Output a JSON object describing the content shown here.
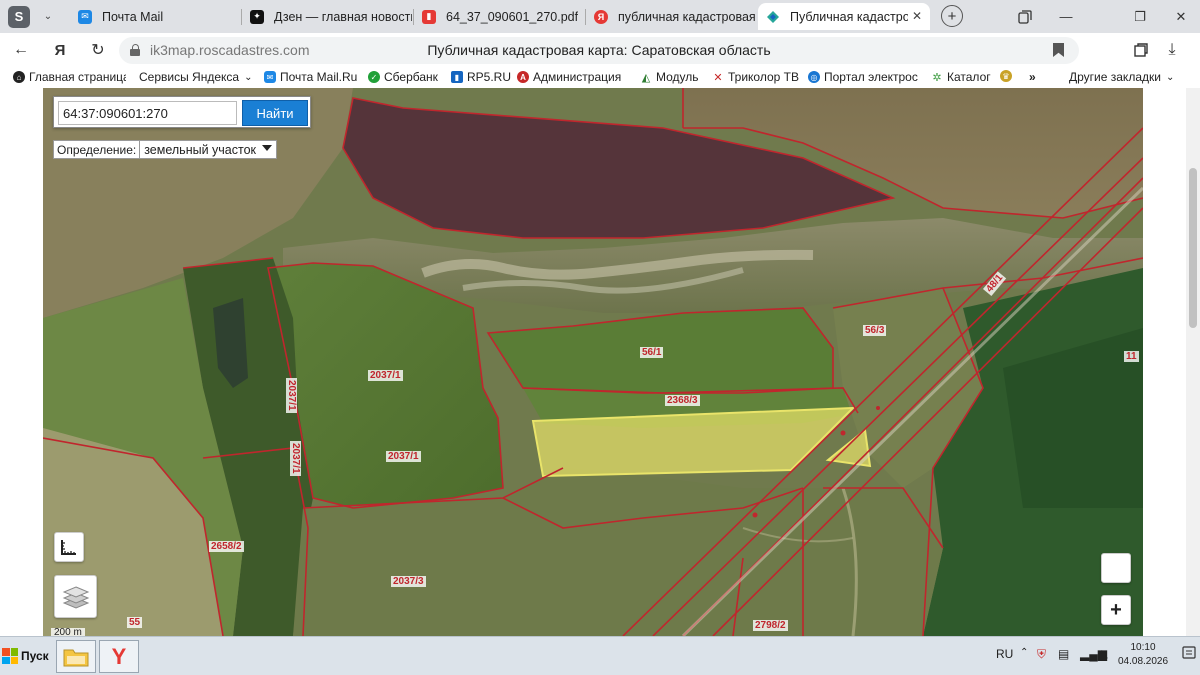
{
  "browser": {
    "tabs": [
      {
        "label": "Почта Mail",
        "icon": "mail-icon",
        "color": "#1e88e5",
        "active": false
      },
      {
        "label": "Дзен — главная новостн",
        "icon": "zen-icon",
        "color": "#111111",
        "active": false
      },
      {
        "label": "64_37_090601_270.pdf",
        "icon": "pdf-icon",
        "color": "#e53935",
        "active": false
      },
      {
        "label": "публичная кадастровая к",
        "icon": "yandex-icon",
        "color": "#e53935",
        "active": false
      },
      {
        "label": "Публичная кадастровая",
        "icon": "cadastre-icon",
        "color": "#1976d2",
        "active": true
      }
    ],
    "logo_letter": "S",
    "new_tab_symbol": "+",
    "url": "ik3map.roscadastres.com",
    "page_title": "Публичная кадастровая карта: Саратовская область",
    "yandex_letter": "Я",
    "bookmarks": [
      {
        "label": "Главная страница",
        "icon": "home-icon",
        "color": "#222222"
      },
      {
        "label": "Сервисы Яндекса",
        "icon": "none",
        "color": ""
      },
      {
        "label": "Почта Mail.Ru",
        "icon": "mail-icon",
        "color": "#1e88e5"
      },
      {
        "label": "Сбербанк",
        "icon": "sber-icon",
        "color": "#21a038"
      },
      {
        "label": "RP5.RU",
        "icon": "rp5-icon",
        "color": "#1565c0"
      },
      {
        "label": "Администрация",
        "icon": "admin-icon",
        "color": "#c62828"
      },
      {
        "label": "Модуль",
        "icon": "module-icon",
        "color": "#2e7d32"
      },
      {
        "label": "Триколор ТВ",
        "icon": "tricolor-icon",
        "color": "#c62828"
      },
      {
        "label": "Портал электрос",
        "icon": "portal-icon",
        "color": "#1976d2"
      },
      {
        "label": "Каталог",
        "icon": "catalog-icon",
        "color": "#43a047"
      }
    ],
    "more_bookmarks": "»",
    "other_bookmarks": "Другие закладки"
  },
  "map": {
    "search": {
      "value": "64:37:090601:270",
      "button": "Найти"
    },
    "definition": {
      "label": "Определение:",
      "selected": "земельный участок"
    },
    "parcel_labels": [
      {
        "text": "56/1"
      },
      {
        "text": "2368/3"
      },
      {
        "text": "56/3"
      },
      {
        "text": "48/1"
      },
      {
        "text": "11"
      },
      {
        "text": "2037/1"
      },
      {
        "text": "2037/1"
      },
      {
        "text": "2037/1"
      },
      {
        "text": "2037/1"
      },
      {
        "text": "2658/2"
      },
      {
        "text": "2037/3"
      },
      {
        "text": "2798/2"
      },
      {
        "text": "55"
      }
    ],
    "scale": "200 m",
    "zoom_in": "+",
    "colors": {
      "parcel_border": "#c0262d",
      "selected_fill": "#e9e46a",
      "search_button": "#1a7fd4"
    }
  },
  "taskbar": {
    "start": "Пуск",
    "lang": "RU",
    "time": "10:10",
    "date": "04.08.2026"
  }
}
